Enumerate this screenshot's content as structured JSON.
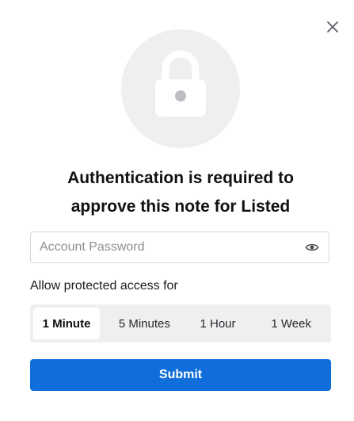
{
  "dialog": {
    "title_line1": "Authentication is required to",
    "title_line2": "approve this note for Listed",
    "close_icon": "close-icon"
  },
  "password": {
    "placeholder": "Account Password",
    "value": "",
    "toggle_icon": "eye-icon"
  },
  "access": {
    "label": "Allow protected access for",
    "options": [
      "1 Minute",
      "5 Minutes",
      "1 Hour",
      "1 Week"
    ],
    "selected": "1 Minute"
  },
  "submit": {
    "label": "Submit"
  },
  "icons": {
    "hero": "lock-icon"
  },
  "colors": {
    "accent": "#0f6ed9",
    "segment_bg": "#efeff1",
    "hero_circle": "#efeff1"
  }
}
